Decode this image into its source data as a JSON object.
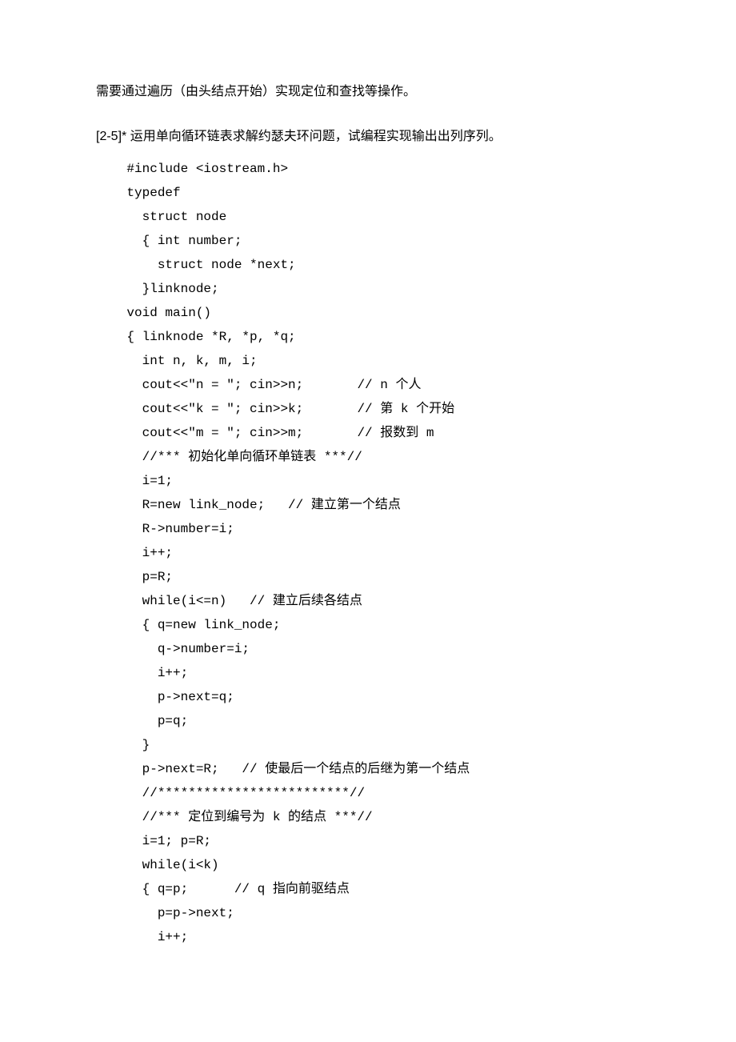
{
  "intro": "需要通过遍历（由头结点开始）实现定位和查找等操作。",
  "question": "[2-5]* 运用单向循环链表求解约瑟夫环问题，试编程实现输出出列序列。",
  "code": {
    "l01": "    #include <iostream.h>",
    "l02": "    typedef",
    "l03": "      struct node",
    "l04": "      { int number;",
    "l05": "        struct node *next;",
    "l06": "      }linknode;",
    "l07": "    void main()",
    "l08": "    { linknode *R, *p, *q;",
    "l09": "      int n, k, m, i;",
    "l10": "      cout<<\"n = \"; cin>>n;       // n 个人",
    "l11": "      cout<<\"k = \"; cin>>k;       // 第 k 个开始",
    "l12": "      cout<<\"m = \"; cin>>m;       // 报数到 m",
    "l13": "",
    "l14": "      //*** 初始化单向循环单链表 ***//",
    "l15": "      i=1;",
    "l16": "      R=new link_node;   // 建立第一个结点",
    "l17": "      R->number=i;",
    "l18": "      i++;",
    "l19": "      p=R;",
    "l20": "      while(i<=n)   // 建立后续各结点",
    "l21": "      { q=new link_node;",
    "l22": "        q->number=i;",
    "l23": "        i++;",
    "l24": "        p->next=q;",
    "l25": "        p=q;",
    "l26": "      }",
    "l27": "      p->next=R;   // 使最后一个结点的后继为第一个结点",
    "l28": "      //*************************//",
    "l29": "",
    "l30": "      //*** 定位到编号为 k 的结点 ***//",
    "l31": "      i=1; p=R;",
    "l32": "      while(i<k)",
    "l33": "      { q=p;      // q 指向前驱结点",
    "l34": "        p=p->next;",
    "l35": "        i++;"
  }
}
